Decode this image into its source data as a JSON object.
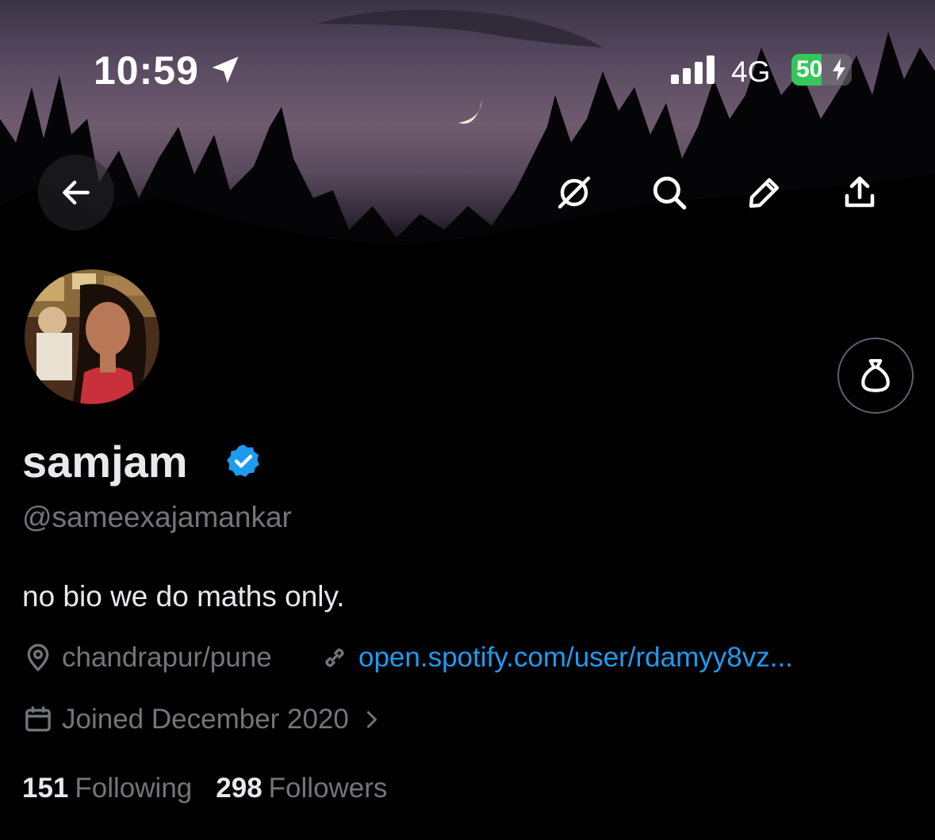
{
  "status_bar": {
    "time": "10:59",
    "network": "4G",
    "battery_percent": "50",
    "battery_level": 0.5,
    "battery_color": "#35c759"
  },
  "icons": {
    "back": "arrow-left-icon",
    "grok": "grok-icon",
    "search": "search-icon",
    "edit": "pencil-icon",
    "share": "share-icon",
    "bag": "money-bag-icon",
    "verified": "verified-badge-icon",
    "location": "location-pin-icon",
    "link": "link-icon",
    "calendar": "calendar-icon",
    "chevron": "chevron-right-icon"
  },
  "profile": {
    "display_name": "samjam",
    "handle": "@sameexajamankar",
    "bio": "no bio we do maths only.",
    "location": "chandrapur/pune",
    "website": "open.spotify.com/user/rdamyy8vz...",
    "joined": "Joined December 2020",
    "following_count": "151",
    "following_label": "Following",
    "followers_count": "298",
    "followers_label": "Followers"
  },
  "colors": {
    "accent": "#1d9bf0",
    "muted_text": "#71767b",
    "primary_text": "#e7e9ea",
    "background": "#000000"
  }
}
